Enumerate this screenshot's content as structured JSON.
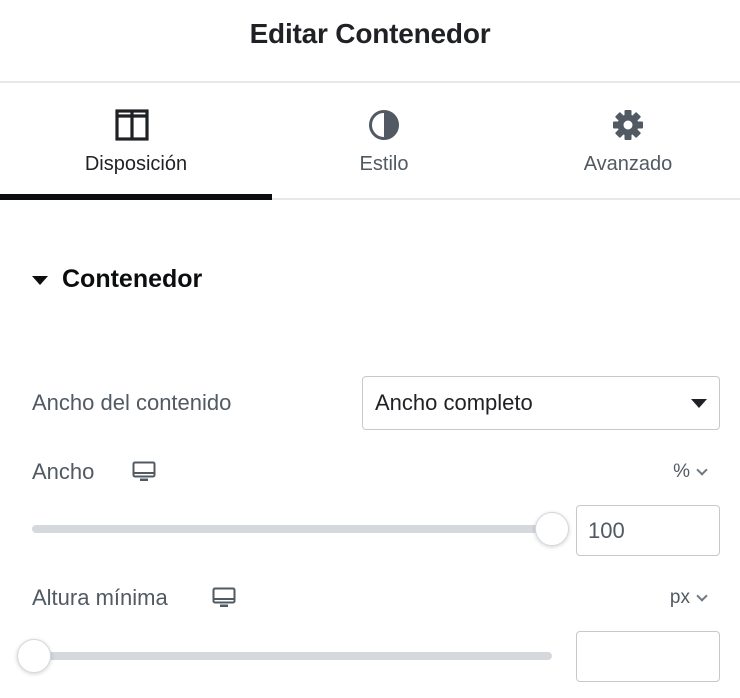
{
  "header": {
    "title": "Editar Contenedor"
  },
  "tabs": [
    {
      "label": "Disposición",
      "icon": "columns-icon",
      "active": true
    },
    {
      "label": "Estilo",
      "icon": "contrast-icon",
      "active": false
    },
    {
      "label": "Avanzado",
      "icon": "gear-icon",
      "active": false
    }
  ],
  "section": {
    "title": "Contenedor",
    "expanded": true
  },
  "controls": {
    "content_width": {
      "label": "Ancho del contenido",
      "value": "Ancho completo"
    },
    "width": {
      "label": "Ancho",
      "unit": "%",
      "value": "100",
      "slider_fraction": 1.0,
      "device_icon": "desktop-icon"
    },
    "min_height": {
      "label": "Altura mínima",
      "unit": "px",
      "value": "",
      "slider_fraction": 0.0,
      "device_icon": "desktop-icon"
    }
  },
  "colors": {
    "active_tab_indicator": "#0c0d0e",
    "text": "#1f2124",
    "muted_text": "#515962",
    "border": "#c5c9cd",
    "track": "#d5d8dc"
  }
}
